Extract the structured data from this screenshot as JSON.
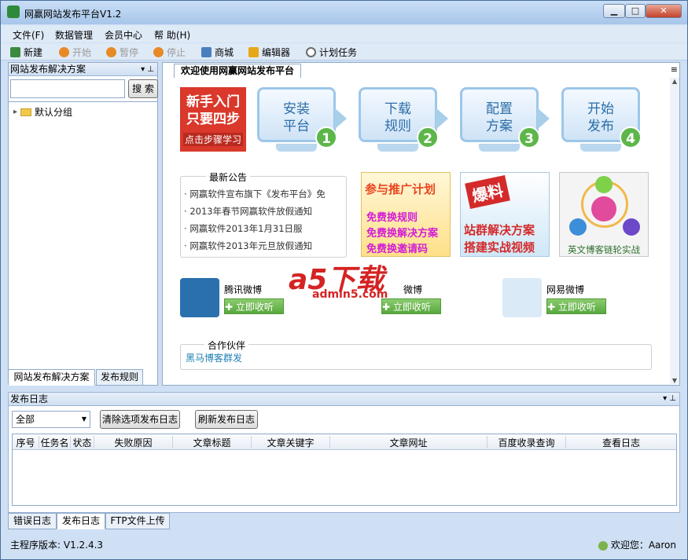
{
  "app": {
    "title": "网赢网站发布平台V1.2"
  },
  "window_controls": {
    "minimize": "▁",
    "maximize": "□",
    "close": "✕"
  },
  "menu": [
    "文件(F)",
    "数据管理",
    "会员中心",
    "帮 助(H)"
  ],
  "toolbar": [
    {
      "label": "新建",
      "icon": "new-icon",
      "enabled": true,
      "color": "#3b8a3e"
    },
    {
      "label": "开始",
      "icon": "play-icon",
      "enabled": false,
      "color": "#e78a25"
    },
    {
      "label": "暂停",
      "icon": "pause-icon",
      "enabled": false,
      "color": "#e78a25"
    },
    {
      "label": "停止",
      "icon": "stop-icon",
      "enabled": false,
      "color": "#e78a25"
    },
    {
      "label": "商城",
      "icon": "store-icon",
      "enabled": true,
      "color": "#4a7fbf"
    },
    {
      "label": "编辑器",
      "icon": "editor-icon",
      "enabled": true,
      "color": "#e6a817"
    },
    {
      "label": "计划任务",
      "icon": "clock-icon",
      "enabled": true,
      "color": "#6b6b6b"
    }
  ],
  "left_panel": {
    "title": "网站发布解决方案",
    "pin": "▾ ⊥",
    "search_button": "搜 索",
    "search_value": "",
    "tree": [
      {
        "label": "默认分组",
        "toggle": "▸"
      }
    ],
    "tabs": [
      "网站发布解决方案",
      "发布规则"
    ]
  },
  "main": {
    "tab": "欢迎使用网赢网站发布平台",
    "menu_glyph": "≡",
    "scroll_up": "▲",
    "scroll_down": "▼",
    "beginner": {
      "line1": "新手入门",
      "line2": "只要四步",
      "link": "点击步骤学习"
    },
    "steps": [
      {
        "num": "1",
        "line1": "安装",
        "line2": "平台"
      },
      {
        "num": "2",
        "line1": "下载",
        "line2": "规则"
      },
      {
        "num": "3",
        "line1": "配置",
        "line2": "方案"
      },
      {
        "num": "4",
        "line1": "开始",
        "line2": "发布"
      }
    ],
    "notice": {
      "title": "最新公告",
      "items": [
        "网赢软件宣布旗下《发布平台》免",
        "2013年春节网赢软件放假通知",
        "网赢软件2013年1月31日服",
        "网赢软件2013年元旦放假通知"
      ]
    },
    "promos": [
      {
        "title": "参与推广计划",
        "lines": [
          "免费换规则",
          "免费换解决方案",
          "免费换邀请码"
        ]
      },
      {
        "title": "爆料",
        "lines": [
          "站群解决方案",
          "搭建实战视频"
        ]
      },
      {
        "title": "",
        "lines": [
          "英文博客链轮实战"
        ]
      }
    ],
    "shares": [
      {
        "name": "腾讯微博",
        "button": "立即收听",
        "icon": "tencent-weibo-icon"
      },
      {
        "name": "微博",
        "button": "立即收听",
        "icon": "sina-weibo-icon"
      },
      {
        "name": "网易微博",
        "button": "立即收听",
        "icon": "netease-weibo-icon"
      }
    ],
    "watermark": {
      "big": "a5下载",
      "small": "admin5.com"
    },
    "partner": {
      "title": "合作伙伴",
      "link": "黑马博客群发"
    }
  },
  "log_panel": {
    "title": "发布日志",
    "pin": "▾ ⊥",
    "filter": "全部",
    "filter_arrow": "▼",
    "clear_button": "清除选项发布日志",
    "refresh_button": "刷新发布日志",
    "columns": [
      "序号",
      "任务名",
      "状态",
      "失败原因",
      "文章标题",
      "文章关键字",
      "文章网址",
      "百度收录查询",
      "查看日志"
    ],
    "tabs": [
      "错误日志",
      "发布日志",
      "FTP文件上传"
    ]
  },
  "status": {
    "version": "主程序版本: V1.2.4.3",
    "user": "欢迎您：Aaron"
  }
}
